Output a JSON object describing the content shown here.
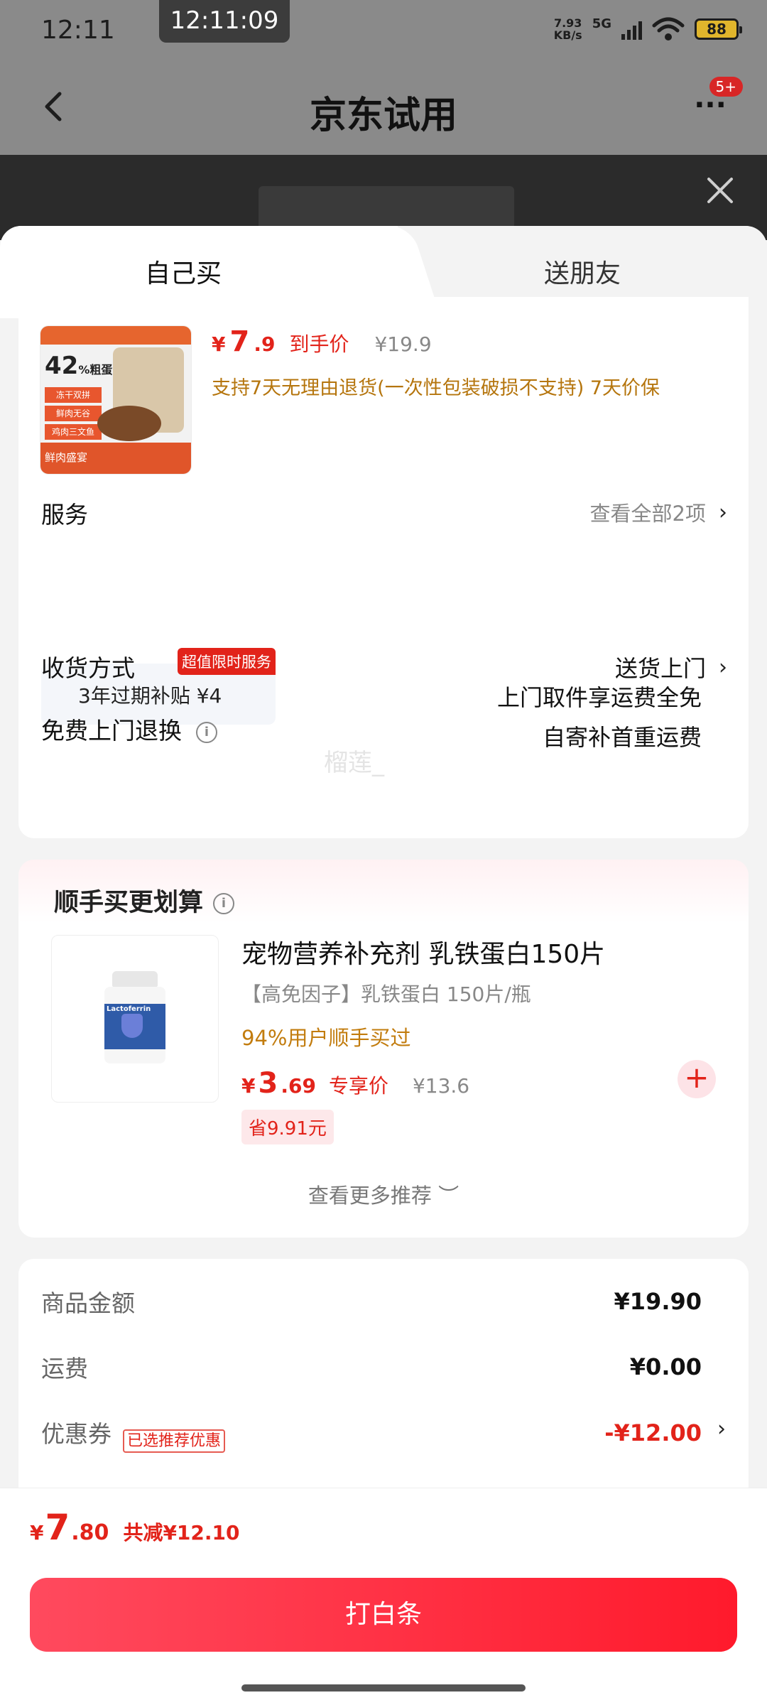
{
  "status": {
    "time": "12:11",
    "clock": "12:11:09",
    "net_speed_value": "7.93",
    "net_speed_unit": "KB/s",
    "network": "5G",
    "battery": "88"
  },
  "nav": {
    "title": "京东试用",
    "badge": "5+"
  },
  "tabs": [
    {
      "label": "自己买"
    },
    {
      "label": "送朋友"
    }
  ],
  "product": {
    "price_yen": "¥",
    "price_int": "7",
    "price_dec": ".9",
    "price_tag": "到手价",
    "price_orig": "¥19.9",
    "policy": "支持7天无理由退货(一次性包装破损不支持) 7天价保",
    "image": {
      "headline": "42",
      "headline_unit": "%",
      "headline_sub": "粗蛋白",
      "tags": [
        "冻干双拼",
        "鲜肉无谷",
        "鸡肉三文鱼"
      ],
      "banner": "鲜肉盛宴"
    }
  },
  "service": {
    "label": "服务",
    "view_all": "查看全部2项",
    "item": "3年过期补贴  ¥4",
    "item_tag": "超值限时服务"
  },
  "delivery": {
    "label": "收货方式",
    "value": "送货上门"
  },
  "return": {
    "label": "免费上门退换",
    "line1": "上门取件享运费全免",
    "line2": "自寄补首重运费"
  },
  "watermark": "榴莲_",
  "recommend": {
    "title": "顺手买更划算",
    "name": "宠物营养补充剂 乳铁蛋白150片",
    "spec": "【高免因子】乳铁蛋白 150片/瓶",
    "bought": "94%用户顺手买过",
    "price_yen": "¥",
    "price_int": "3",
    "price_dec": ".69",
    "price_tag": "专享价",
    "price_orig": "¥13.6",
    "save": "省9.91元",
    "bottle_label": "Lactoferrin",
    "see_more": "查看更多推荐 ︶"
  },
  "summary": {
    "goods_label": "商品金额",
    "goods_value": "¥19.90",
    "shipping_label": "运费",
    "shipping_value": "¥0.00",
    "coupon_label": "优惠券",
    "coupon_tag": "已选推荐优惠",
    "coupon_value": "-¥12.00"
  },
  "bottom": {
    "total_yen": "¥",
    "total_int": "7",
    "total_dec": ".80",
    "total_save": "共减¥12.10",
    "pay_label": "打白条"
  }
}
